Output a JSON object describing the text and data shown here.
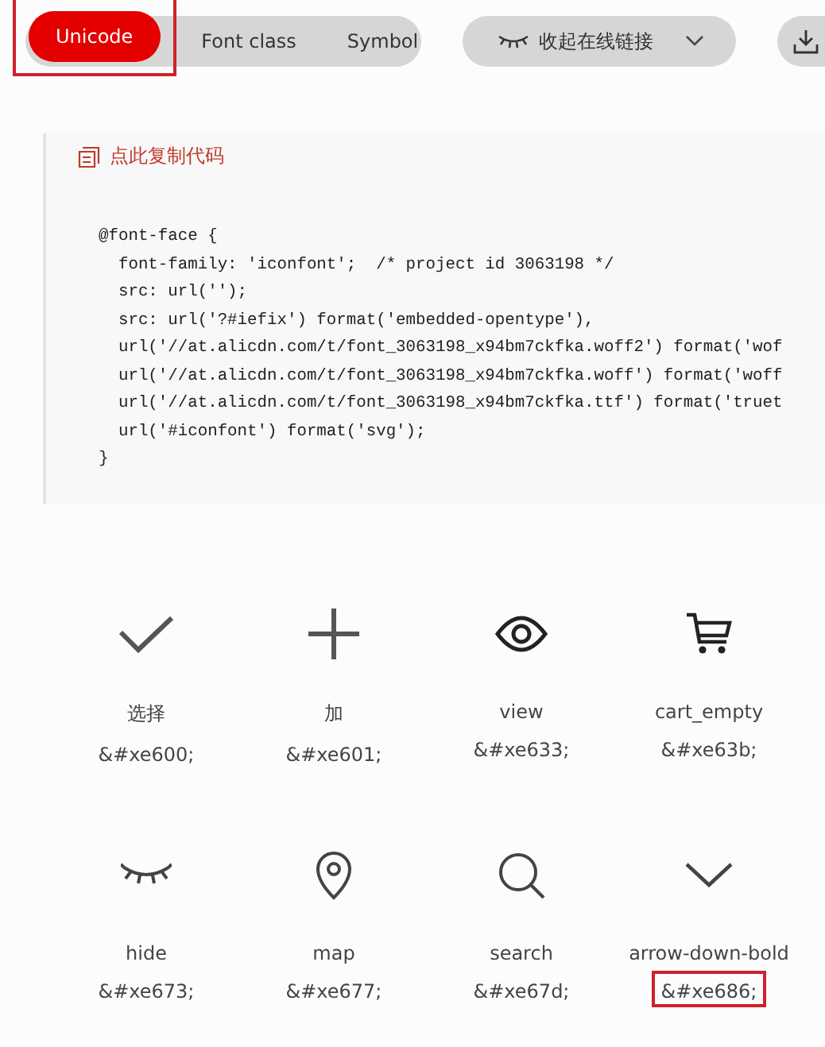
{
  "tabs": [
    {
      "label": "Unicode",
      "selected": true,
      "highlighted": true
    },
    {
      "label": "Font class",
      "selected": false,
      "highlighted": false
    },
    {
      "label": "Symbol",
      "selected": false,
      "highlighted": false
    }
  ],
  "link_toggle": {
    "label": "收起在线链接",
    "expanded": true
  },
  "copy_link": "点此复制代码",
  "code_lines": [
    "@font-face {",
    "  font-family: 'iconfont';  /* project id 3063198 */",
    "  src: url('');",
    "  src: url('?#iefix') format('embedded-opentype'),",
    "  url('//at.alicdn.com/t/font_3063198_x94bm7ckfka.woff2') format('wof",
    "  url('//at.alicdn.com/t/font_3063198_x94bm7ckfka.woff') format('woff",
    "  url('//at.alicdn.com/t/font_3063198_x94bm7ckfka.ttf') format('truet",
    "  url('#iconfont') format('svg');",
    "}"
  ],
  "icons": [
    {
      "kind": "check",
      "name": "选择",
      "code": "&#xe600;",
      "highlighted": false
    },
    {
      "kind": "plus",
      "name": "加",
      "code": "&#xe601;",
      "highlighted": false
    },
    {
      "kind": "eye",
      "name": "view",
      "code": "&#xe633;",
      "highlighted": false
    },
    {
      "kind": "cart",
      "name": "cart_empty",
      "code": "&#xe63b;",
      "highlighted": false
    },
    {
      "kind": "closed-eye",
      "name": "hide",
      "code": "&#xe673;",
      "highlighted": false
    },
    {
      "kind": "pin",
      "name": "map",
      "code": "&#xe677;",
      "highlighted": false
    },
    {
      "kind": "search",
      "name": "search",
      "code": "&#xe67d;",
      "highlighted": false
    },
    {
      "kind": "chevron",
      "name": "arrow-down-bold",
      "code": "&#xe686;",
      "highlighted": true
    }
  ]
}
